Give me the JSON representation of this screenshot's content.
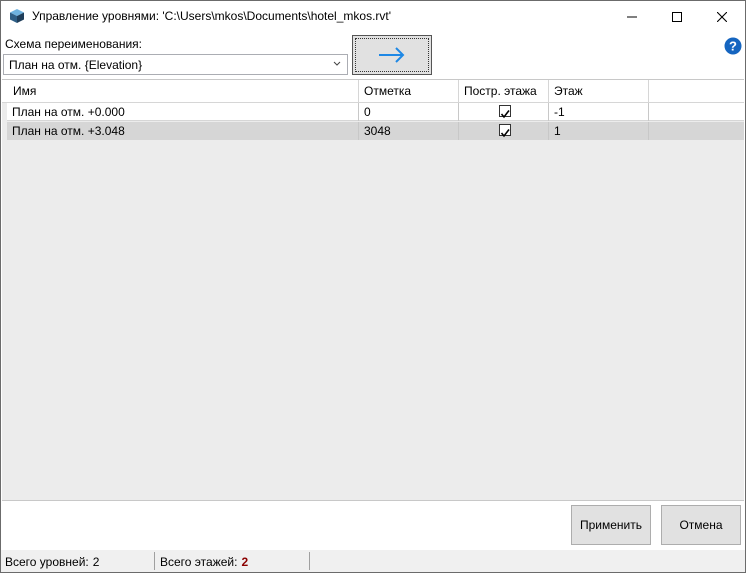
{
  "window": {
    "title": "Управление уровнями: 'C:\\Users\\mkos\\Documents\\hotel_mkos.rvt'"
  },
  "scheme": {
    "label": "Схема переименования:",
    "selected": "План на отм. {Elevation}"
  },
  "grid": {
    "columns": [
      "Имя",
      "Отметка",
      "Постр. этажа",
      "Этаж"
    ],
    "rows": [
      {
        "name": "План на отм. +0.000",
        "elevation": "0",
        "building_story": true,
        "floor": "-1"
      },
      {
        "name": "План на отм. +3.048",
        "elevation": "3048",
        "building_story": true,
        "floor": "1"
      }
    ]
  },
  "buttons": {
    "apply": "Применить",
    "cancel": "Отмена"
  },
  "status": {
    "levels_label": "Всего уровней:",
    "levels_value": "2",
    "floors_label": "Всего этажей:",
    "floors_value": "2"
  },
  "colors": {
    "arrow": "#1e88e5",
    "help": "#1565c0",
    "floors_value": "#8b0000"
  },
  "icons": {
    "app": "revit-cube-icon",
    "apply_scheme": "arrow-right-icon",
    "help": "help-icon"
  }
}
